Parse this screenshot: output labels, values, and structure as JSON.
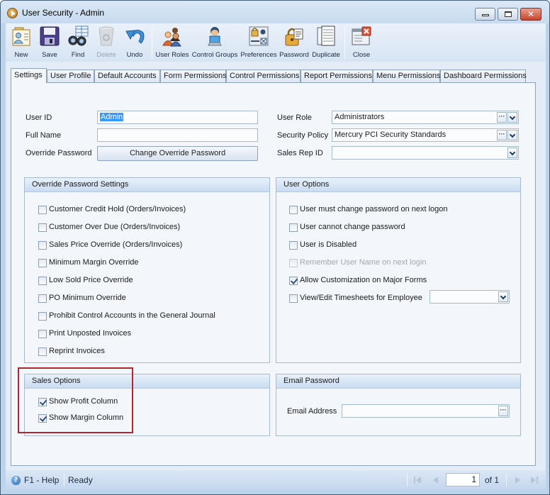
{
  "window": {
    "title": "User Security - Admin",
    "controls": {
      "minimize": "minimize",
      "maximize": "maximize",
      "close": "✕"
    }
  },
  "toolbar": {
    "buttons": [
      {
        "label": "New",
        "icon": "new-user-icon",
        "enabled": true
      },
      {
        "label": "Save",
        "icon": "floppy-disk-icon",
        "enabled": true
      },
      {
        "label": "Find",
        "icon": "binoculars-icon",
        "enabled": true
      },
      {
        "label": "Delete",
        "icon": "trash-bin-icon",
        "enabled": false
      },
      {
        "label": "Undo",
        "icon": "undo-arrow-icon",
        "enabled": true
      },
      {
        "label": "User Roles",
        "icon": "user-group-icon",
        "enabled": true
      },
      {
        "label": "Control Groups",
        "icon": "user-computer-icon",
        "enabled": true
      },
      {
        "label": "Preferences",
        "icon": "preferences-icon",
        "enabled": true
      },
      {
        "label": "Password",
        "icon": "padlock-icon",
        "enabled": true
      },
      {
        "label": "Duplicate",
        "icon": "duplicate-document-icon",
        "enabled": true
      },
      {
        "label": "Close",
        "icon": "close-window-icon",
        "enabled": true
      }
    ]
  },
  "tabs": [
    {
      "label": "Settings",
      "active": true
    },
    {
      "label": "User Profile",
      "active": false
    },
    {
      "label": "Default Accounts",
      "active": false
    },
    {
      "label": "Form Permissions",
      "active": false
    },
    {
      "label": "Control Permissions",
      "active": false
    },
    {
      "label": "Report Permissions",
      "active": false
    },
    {
      "label": "Menu Permissions",
      "active": false
    },
    {
      "label": "Dashboard Permissions",
      "active": false
    }
  ],
  "settings": {
    "user_id": {
      "label": "User ID",
      "value": "Admin"
    },
    "full_name": {
      "label": "Full Name",
      "value": ""
    },
    "override_password": {
      "label": "Override Password",
      "button": "Change Override Password"
    },
    "user_role": {
      "label": "User Role",
      "value": "Administrators"
    },
    "security_policy": {
      "label": "Security Policy",
      "value": "Mercury PCI Security Standards"
    },
    "sales_rep_id": {
      "label": "Sales Rep ID",
      "value": ""
    },
    "ellipsis": "···"
  },
  "override_password_settings": {
    "title": "Override Password Settings",
    "items": [
      {
        "label": "Customer Credit Hold (Orders/Invoices)",
        "checked": false
      },
      {
        "label": "Customer Over Due (Orders/Invoices)",
        "checked": false
      },
      {
        "label": "Sales Price Override (Orders/Invoices)",
        "checked": false
      },
      {
        "label": "Minimum Margin Override",
        "checked": false
      },
      {
        "label": "Low Sold Price Override",
        "checked": false
      },
      {
        "label": "PO Minimum Override",
        "checked": false
      },
      {
        "label": "Prohibit Control Accounts in the General Journal",
        "checked": false
      },
      {
        "label": "Print Unposted Invoices",
        "checked": false
      },
      {
        "label": "Reprint Invoices",
        "checked": false
      }
    ]
  },
  "user_options": {
    "title": "User Options",
    "items": [
      {
        "label": "User must change password on next logon",
        "checked": false,
        "enabled": true
      },
      {
        "label": "User cannot change password",
        "checked": false,
        "enabled": true
      },
      {
        "label": "User is Disabled",
        "checked": false,
        "enabled": true
      },
      {
        "label": "Remember User Name on next login",
        "checked": false,
        "enabled": false
      },
      {
        "label": "Allow Customization on Major Forms",
        "checked": true,
        "enabled": true
      },
      {
        "label": "View/Edit Timesheets for Employee",
        "checked": false,
        "enabled": true
      }
    ],
    "employee_select_value": ""
  },
  "sales_options": {
    "title": "Sales Options",
    "items": [
      {
        "label": "Show Profit Column",
        "checked": true
      },
      {
        "label": "Show Margin Column",
        "checked": true
      }
    ]
  },
  "email_password": {
    "title": "Email Password",
    "email_address": {
      "label": "Email Address",
      "value": ""
    }
  },
  "statusbar": {
    "help": "F1 - Help",
    "status": "Ready",
    "page_current": "1",
    "page_of": "of 1"
  },
  "colors": {
    "highlight_box": "#b3262b",
    "selection": "#3399ff",
    "window_frame": "#bcd3ec"
  }
}
